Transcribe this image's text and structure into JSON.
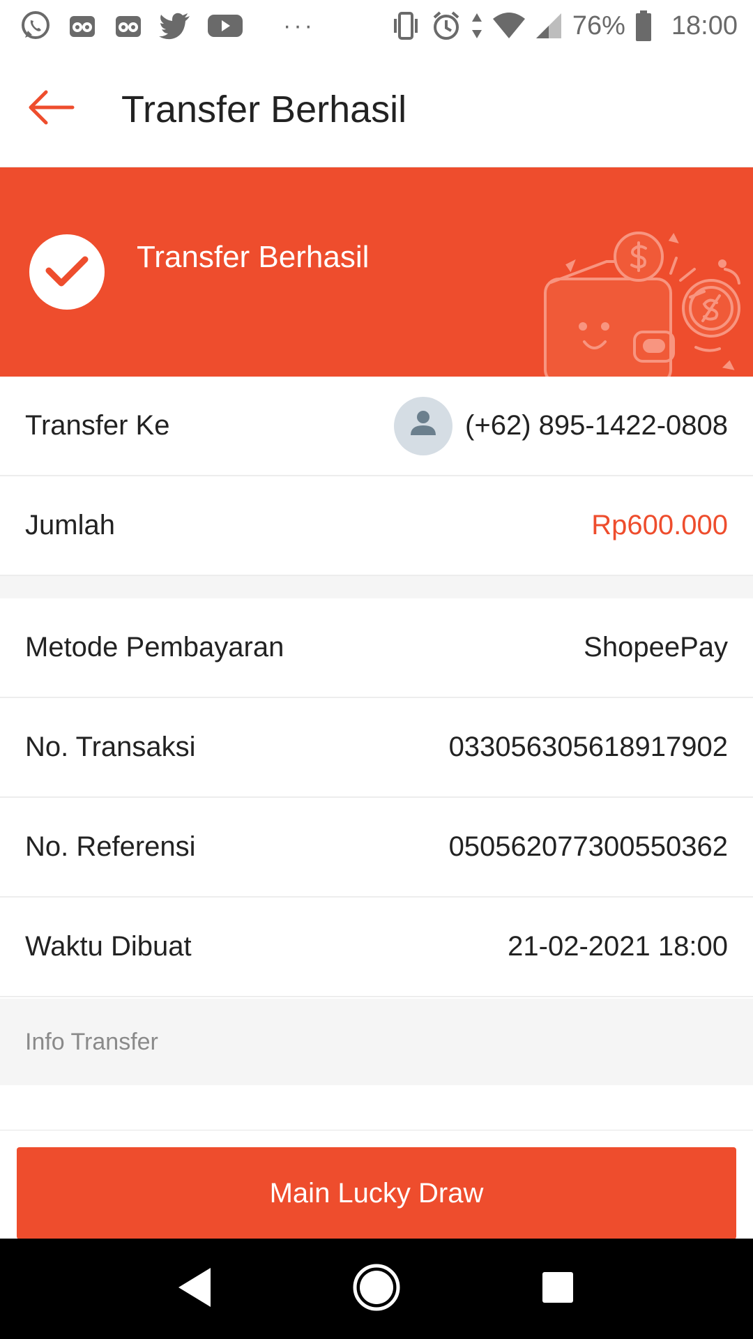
{
  "status_bar": {
    "battery_percent": "76%",
    "time": "18:00",
    "left_icons": [
      "whatsapp-icon",
      "tripadvisor-icon",
      "tripadvisor-icon",
      "twitter-icon",
      "youtube-icon",
      "more-dots-icon"
    ],
    "right_icons": [
      "vibrate-icon",
      "alarm-icon",
      "data-arrows-icon",
      "wifi-icon",
      "signal-icon",
      "battery-icon"
    ]
  },
  "header": {
    "title": "Transfer Berhasil",
    "back_icon": "arrow-left-icon"
  },
  "banner": {
    "title": "Transfer Berhasil",
    "icon": "check-circle-icon"
  },
  "details": {
    "recipient": {
      "label": "Transfer Ke",
      "value": "(+62) 895-1422-0808"
    },
    "amount": {
      "label": "Jumlah",
      "value": "Rp600.000"
    },
    "payment_method": {
      "label": "Metode Pembayaran",
      "value": "ShopeePay"
    },
    "transaction_no": {
      "label": "No. Transaksi",
      "value": "033056305618917902"
    },
    "reference_no": {
      "label": "No. Referensi",
      "value": "050562077300550362"
    },
    "created_time": {
      "label": "Waktu Dibuat",
      "value": "21-02-2021 18:00"
    }
  },
  "info_section": {
    "title": "Info Transfer"
  },
  "action": {
    "button_label": "Main Lucky Draw"
  },
  "colors": {
    "accent": "#ee4d2d",
    "section_bg": "#f5f5f5",
    "divider": "#ededed"
  },
  "nav_bar": {
    "icons": [
      "back-triangle-icon",
      "home-circle-icon",
      "recents-square-icon"
    ]
  }
}
